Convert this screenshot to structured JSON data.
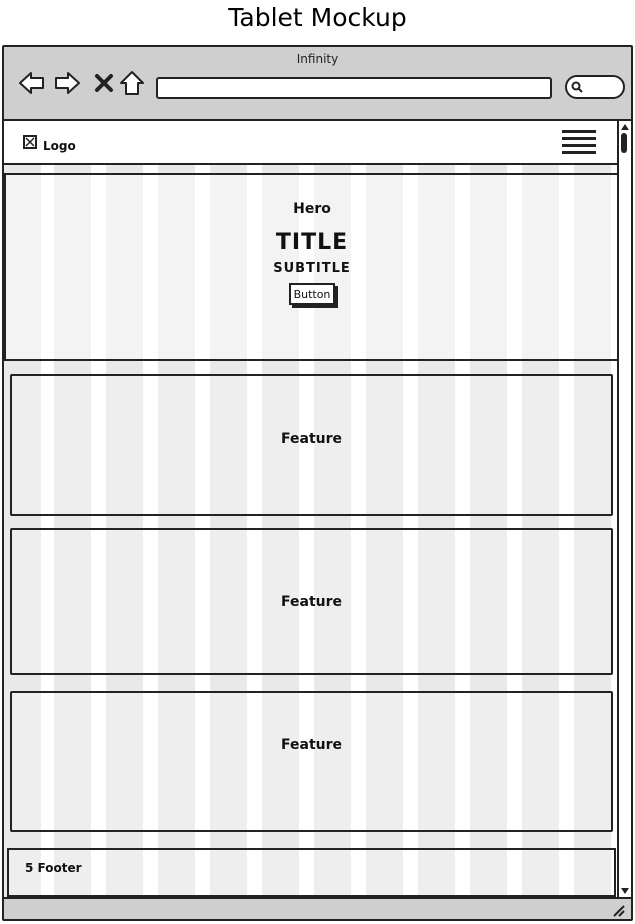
{
  "mockup": {
    "title": "Tablet Mockup"
  },
  "browser": {
    "window_title": "Infinity",
    "address_value": "",
    "nav_icons": [
      "back-arrow-icon",
      "forward-arrow-icon",
      "stop-icon",
      "home-icon"
    ],
    "search_icon": "search-icon"
  },
  "site": {
    "logo_label": "Logo",
    "menu_icon": "hamburger-menu-icon",
    "hero": {
      "label": "Hero",
      "title": "TITLE",
      "subtitle": "SUBTITLE",
      "button_label": "Button"
    },
    "features": [
      {
        "label": "Feature"
      },
      {
        "label": "Feature"
      },
      {
        "label": "Feature"
      }
    ],
    "footer_label": "5 Footer"
  },
  "colors": {
    "chrome": "#cfcfcf",
    "grid_column": "#e9e9e9",
    "stroke": "#222222"
  }
}
